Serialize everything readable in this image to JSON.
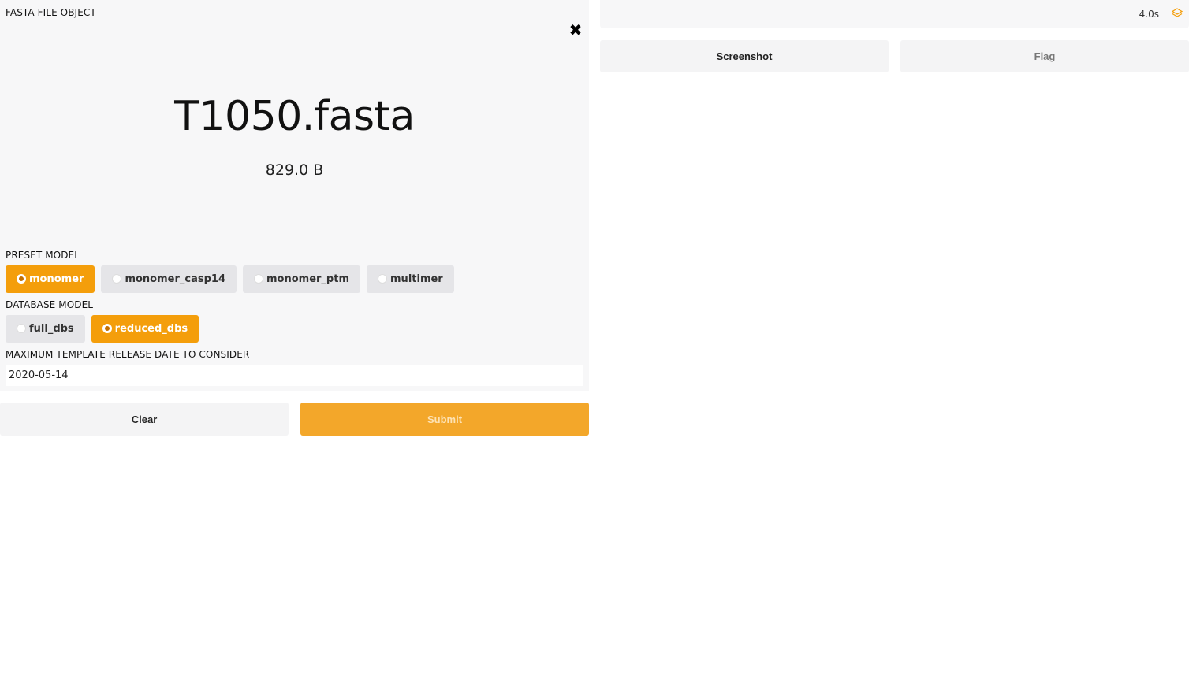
{
  "file_panel": {
    "title": "FASTA FILE OBJECT",
    "file_name": "T1050.fasta",
    "file_size": "829.0 B",
    "close_icon": "close-icon"
  },
  "preset_model": {
    "label": "PRESET MODEL",
    "options": [
      "monomer",
      "monomer_casp14",
      "monomer_ptm",
      "multimer"
    ],
    "selected": "monomer"
  },
  "database_model": {
    "label": "DATABASE MODEL",
    "options": [
      "full_dbs",
      "reduced_dbs"
    ],
    "selected": "reduced_dbs"
  },
  "template_date": {
    "label": "MAXIMUM TEMPLATE RELEASE DATE TO CONSIDER",
    "value": "2020-05-14"
  },
  "actions": {
    "clear_label": "Clear",
    "submit_label": "Submit"
  },
  "output": {
    "timer": "4.0s",
    "logo_icon": "gradio-logo-icon",
    "screenshot_label": "Screenshot",
    "flag_label": "Flag"
  },
  "colors": {
    "accent": "#f49e0b",
    "panel_bg": "#f7f7f8"
  }
}
